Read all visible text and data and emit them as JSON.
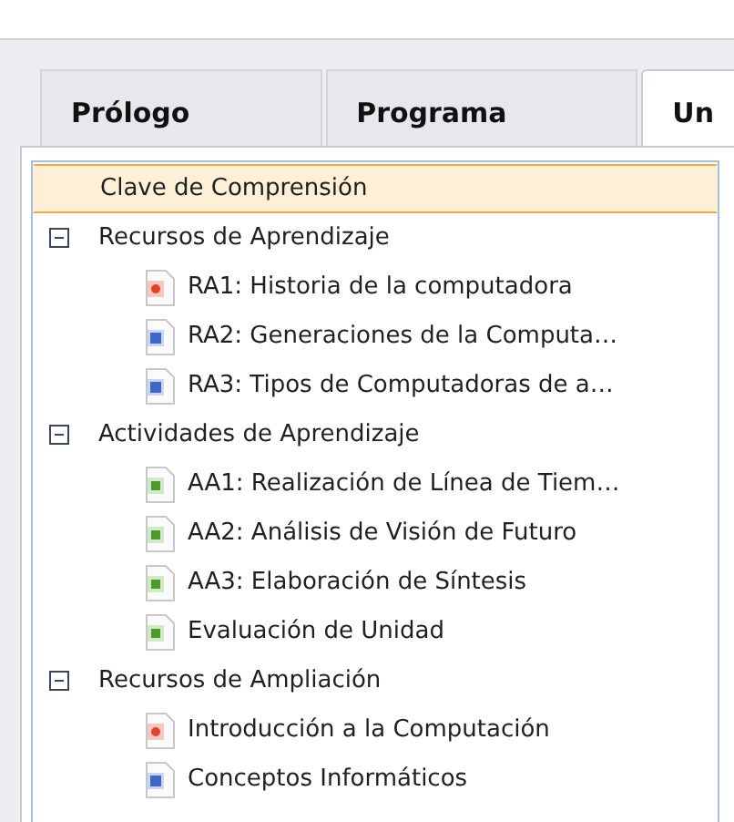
{
  "tabs": [
    {
      "label": "Prólogo",
      "selected": false
    },
    {
      "label": "Programa",
      "selected": false
    },
    {
      "label": "Un",
      "selected": true
    }
  ],
  "tree": [
    {
      "label": "Clave de Comprensión",
      "kind": "leaf",
      "selected": true
    },
    {
      "label": "Recursos de Aprendizaje",
      "kind": "group",
      "selected": false,
      "expanded": true,
      "children": [
        {
          "label": "RA1: Historia de la computadora",
          "kind": "presentation",
          "selected": false
        },
        {
          "label": "RA2: Generaciones de la Computa…",
          "kind": "document",
          "selected": false
        },
        {
          "label": "RA3: Tipos de Computadoras de a…",
          "kind": "document",
          "selected": false
        }
      ]
    },
    {
      "label": "Actividades de Aprendizaje",
      "kind": "group",
      "selected": false,
      "expanded": true,
      "children": [
        {
          "label": "AA1: Realización de Línea de Tiem…",
          "kind": "image",
          "selected": false
        },
        {
          "label": "AA2: Análisis de Visión de Futuro",
          "kind": "image",
          "selected": false
        },
        {
          "label": "AA3: Elaboración de Síntesis",
          "kind": "image",
          "selected": false
        },
        {
          "label": "Evaluación de Unidad",
          "kind": "image",
          "selected": false
        }
      ]
    },
    {
      "label": "Recursos de Ampliación",
      "kind": "group",
      "selected": false,
      "expanded": true,
      "children": [
        {
          "label": "Introducción a la Computación",
          "kind": "presentation",
          "selected": false
        },
        {
          "label": "Conceptos Informáticos",
          "kind": "document",
          "selected": false
        }
      ]
    }
  ]
}
